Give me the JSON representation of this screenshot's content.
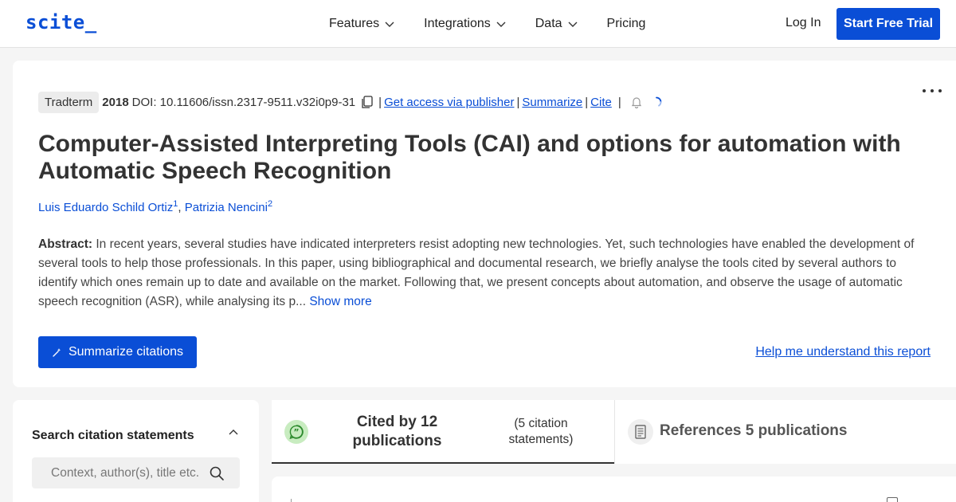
{
  "header": {
    "logo": "scite_",
    "nav": [
      {
        "label": "Features",
        "has_dropdown": true
      },
      {
        "label": "Integrations",
        "has_dropdown": true
      },
      {
        "label": "Data",
        "has_dropdown": true
      },
      {
        "label": "Pricing",
        "has_dropdown": false
      }
    ],
    "login_label": "Log In",
    "trial_label": "Start Free Trial"
  },
  "paper": {
    "journal": "Tradterm",
    "year": "2018",
    "doi": "DOI: 10.11606/issn.2317-9511.v32i0p9-31",
    "separator": "|",
    "links": {
      "access": "Get access via publisher",
      "summarize": "Summarize",
      "cite": "Cite"
    },
    "title": "Computer-Assisted Interpreting Tools (CAI) and options for automation with Automatic Speech Recognition",
    "authors": [
      {
        "name": "Luis Eduardo Schild Ortiz",
        "sup": "1"
      },
      {
        "name": "Patrizia Nencini",
        "sup": "2"
      }
    ],
    "author_separator": ", ",
    "abstract_label": "Abstract:",
    "abstract_text": " In recent years, several studies have indicated interpreters resist adopting new technologies. Yet, such technologies have enabled the development of several tools to help those professionals. In this paper, using bibliographical and documental research, we briefly analyse the tools cited by several authors to identify which ones remain up to date and available on the market. Following that, we present concepts about automation, and observe the usage of automatic speech recognition (ASR), while analysing its p... ",
    "show_more": "Show more",
    "summarize_citations_label": "Summarize citations",
    "help_link": "Help me understand this report"
  },
  "sidebar": {
    "title": "Search citation statements",
    "search_placeholder": "Context, author(s), title etc."
  },
  "tabs": {
    "cited": {
      "label": "Cited by 12 publications",
      "sub": "(5 citation statements)"
    },
    "references": {
      "label": "References 5 publications"
    }
  },
  "colors": {
    "brand": "#0a4ed6",
    "quote_badge": "#c8ecc0",
    "quote_icon": "#2e8b2e"
  }
}
